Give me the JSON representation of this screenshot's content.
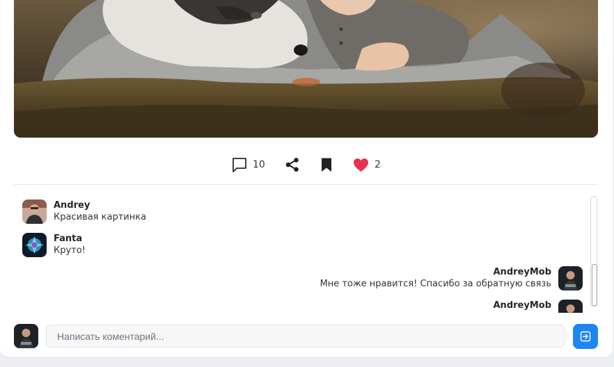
{
  "post": {
    "image_alt": "Husky dog lying next to a child on a blanket in grass",
    "actions": {
      "comments_icon": "comment-icon",
      "comments_count": "10",
      "share_icon": "share-icon",
      "bookmark_icon": "bookmark-icon",
      "like_icon": "heart-icon",
      "likes_count": "2"
    },
    "colors": {
      "like": "#e8334f",
      "send": "#1d86f0",
      "background": "#eceef1"
    }
  },
  "comments": [
    {
      "user": "Andrey",
      "text": "Красивая картинка",
      "side": "left"
    },
    {
      "user": "Fanta",
      "text": "Круто!",
      "side": "left"
    },
    {
      "user": "AndreyMob",
      "text": "Мне тоже нравится! Спасибо за обратную связь",
      "side": "right"
    },
    {
      "user": "AndreyMob",
      "text": "",
      "side": "right"
    }
  ],
  "composer": {
    "placeholder": "Написать коментарий...",
    "send_icon": "arrow-right-icon"
  }
}
